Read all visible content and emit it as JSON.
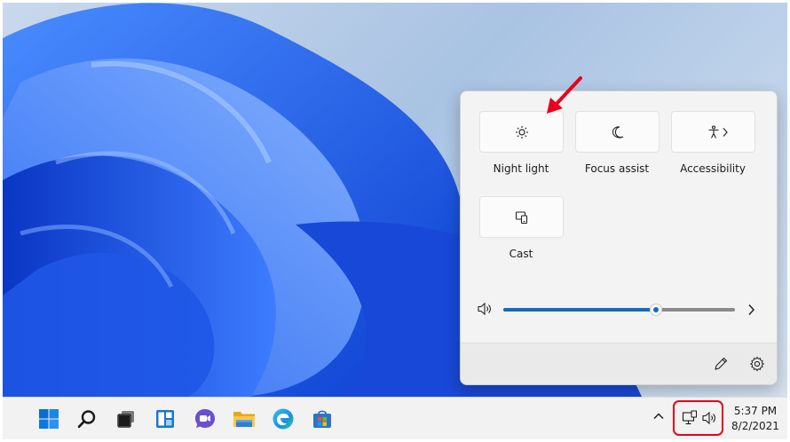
{
  "quick_settings": {
    "tiles": [
      {
        "label": "Night light",
        "icon": "brightness-icon"
      },
      {
        "label": "Focus assist",
        "icon": "moon-icon"
      },
      {
        "label": "Accessibility",
        "icon": "accessibility-icon",
        "has_chevron": true
      },
      {
        "label": "Cast",
        "icon": "cast-icon"
      }
    ],
    "volume": {
      "icon": "speaker-icon",
      "level": 0.66
    },
    "footer": {
      "edit_icon": "pencil-icon",
      "settings_icon": "gear-icon"
    }
  },
  "taskbar": {
    "apps": [
      {
        "name": "start",
        "icon": "windows-logo-icon"
      },
      {
        "name": "search",
        "icon": "search-icon"
      },
      {
        "name": "task-view",
        "icon": "task-view-icon"
      },
      {
        "name": "widgets",
        "icon": "widgets-icon"
      },
      {
        "name": "chat",
        "icon": "teams-chat-icon"
      },
      {
        "name": "file-explorer",
        "icon": "folder-icon"
      },
      {
        "name": "edge",
        "icon": "edge-icon"
      },
      {
        "name": "store",
        "icon": "store-icon"
      }
    ],
    "tray": {
      "chevron_icon": "chevron-up-icon",
      "network_icon": "network-icon",
      "volume_icon": "speaker-icon"
    },
    "clock": {
      "time": "5:37 PM",
      "date": "8/2/2021"
    }
  },
  "colors": {
    "accent": "#1a68c4",
    "annotation": "#e8001c",
    "wallpaper_blue": "#1f57e6"
  }
}
